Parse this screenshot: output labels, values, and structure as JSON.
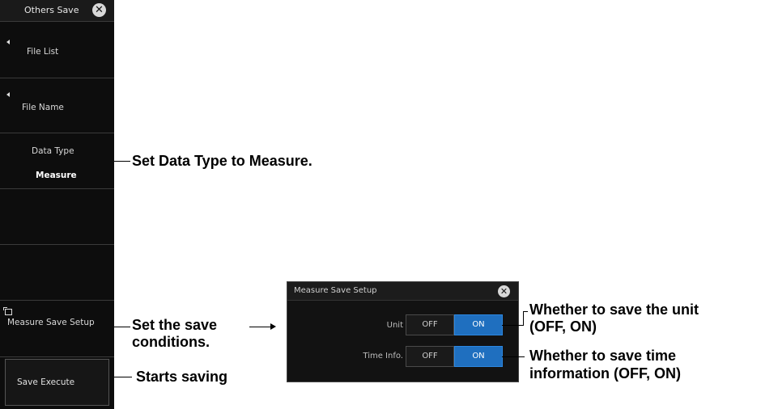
{
  "menu": {
    "title": "Others Save",
    "items": [
      {
        "label": "File List"
      },
      {
        "label": "File Name"
      },
      {
        "label": "Data Type",
        "value": "Measure"
      },
      {
        "label": "Measure Save Setup"
      },
      {
        "label": "Save Execute"
      }
    ]
  },
  "dialog": {
    "title": "Measure Save Setup",
    "rows": [
      {
        "label": "Unit",
        "off": "OFF",
        "on": "ON",
        "selected": "ON"
      },
      {
        "label": "Time Info.",
        "off": "OFF",
        "on": "ON",
        "selected": "ON"
      }
    ]
  },
  "annotations": {
    "data_type": "Set Data Type to Measure.",
    "save_conditions_1": "Set the save",
    "save_conditions_2": "conditions.",
    "starts_saving": "Starts saving",
    "unit_1": "Whether to save the unit",
    "unit_2": "(OFF, ON)",
    "time_1": "Whether to save time",
    "time_2": "information (OFF, ON)"
  },
  "colors": {
    "on_selected": "#1f6fbf",
    "menu_bg": "#0d0d0d"
  }
}
